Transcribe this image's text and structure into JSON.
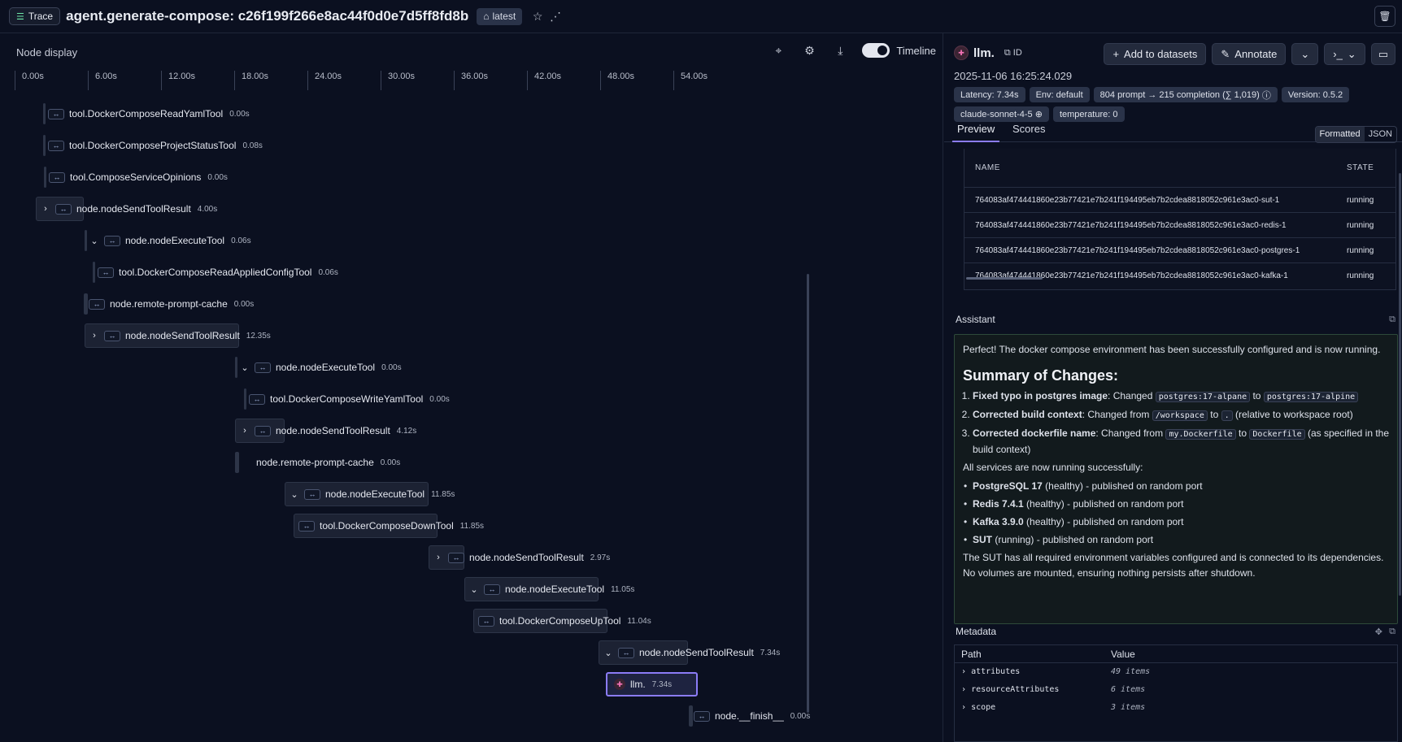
{
  "topbar": {
    "trace_label": "Trace",
    "title": "agent.generate-compose: c26f199f266e8ac44f0d0e7d5ff8fd8b",
    "tag": "latest"
  },
  "left": {
    "header": "Node display",
    "timeline_label": "Timeline",
    "ticks": [
      "0.00s",
      "6.00s",
      "12.00s",
      "18.00s",
      "24.00s",
      "30.00s",
      "36.00s",
      "42.00s",
      "48.00s",
      "54.00s"
    ],
    "nodes": [
      {
        "name": "tool.DockerComposeReadYamlTool",
        "dur": "0.00s"
      },
      {
        "name": "tool.DockerComposeProjectStatusTool",
        "dur": "0.08s"
      },
      {
        "name": "tool.ComposeServiceOpinions",
        "dur": "0.00s"
      },
      {
        "name": "node.nodeSendToolResult",
        "dur": "4.00s"
      },
      {
        "name": "node.nodeExecuteTool",
        "dur": "0.06s"
      },
      {
        "name": "tool.DockerComposeReadAppliedConfigTool",
        "dur": "0.06s"
      },
      {
        "name": "node.remote-prompt-cache",
        "dur": "0.00s"
      },
      {
        "name": "node.nodeSendToolResult",
        "dur": "12.35s"
      },
      {
        "name": "node.nodeExecuteTool",
        "dur": "0.00s"
      },
      {
        "name": "tool.DockerComposeWriteYamlTool",
        "dur": "0.00s"
      },
      {
        "name": "node.nodeSendToolResult",
        "dur": "4.12s"
      },
      {
        "name": "node.remote-prompt-cache",
        "dur": "0.00s"
      },
      {
        "name": "node.nodeExecuteTool",
        "dur": "11.85s"
      },
      {
        "name": "tool.DockerComposeDownTool",
        "dur": "11.85s"
      },
      {
        "name": "node.nodeSendToolResult",
        "dur": "2.97s"
      },
      {
        "name": "node.nodeExecuteTool",
        "dur": "11.05s"
      },
      {
        "name": "tool.DockerComposeUpTool",
        "dur": "11.04s"
      },
      {
        "name": "node.nodeSendToolResult",
        "dur": "7.34s"
      },
      {
        "name": "llm.",
        "dur": "7.34s"
      },
      {
        "name": "node.__finish__",
        "dur": "0.00s"
      }
    ]
  },
  "right": {
    "span_name": "llm.",
    "id_label": "ID",
    "actions": {
      "add": "Add to datasets",
      "annotate": "Annotate"
    },
    "timestamp": "2025-11-06 16:25:24.029",
    "chips": {
      "latency": "Latency: 7.34s",
      "env": "Env: default",
      "tokens": "804 prompt → 215 completion (∑ 1,019)",
      "version": "Version: 0.5.2",
      "model": "claude-sonnet-4-5",
      "temperature": "temperature: 0"
    },
    "tabs": {
      "preview": "Preview",
      "scores": "Scores"
    },
    "format": {
      "formatted": "Formatted",
      "json": "JSON"
    },
    "table": {
      "col_name": "NAME",
      "col_state": "STATE",
      "rows": [
        {
          "name": "764083af474441860e23b77421e7b241f194495eb7b2cdea8818052c961e3ac0-sut-1",
          "state": "running"
        },
        {
          "name": "764083af474441860e23b77421e7b241f194495eb7b2cdea8818052c961e3ac0-redis-1",
          "state": "running"
        },
        {
          "name": "764083af474441860e23b77421e7b241f194495eb7b2cdea8818052c961e3ac0-postgres-1",
          "state": "running"
        },
        {
          "name": "764083af474441860e23b77421e7b241f194495eb7b2cdea8818052c961e3ac0-kafka-1",
          "state": "running"
        }
      ]
    },
    "assistant": {
      "label": "Assistant",
      "intro": "Perfect! The docker compose environment has been successfully configured and is now running.",
      "heading": "Summary of Changes:",
      "c1_bold": "Fixed typo in postgres image",
      "c1_text": ": Changed ",
      "c1_code_a": "postgres:17-alpane",
      "c1_mid": " to ",
      "c1_code_b": "postgres:17-alpine",
      "c2_bold": "Corrected build context",
      "c2_text": ": Changed from ",
      "c2_code_a": "/workspace",
      "c2_mid": " to ",
      "c2_code_b": ".",
      "c2_tail": " (relative to workspace root)",
      "c3_bold": "Corrected dockerfile name",
      "c3_text": ": Changed from ",
      "c3_code_a": "my.Dockerfile",
      "c3_mid": " to ",
      "c3_code_b": "Dockerfile",
      "c3_tail": " (as specified in the build context)",
      "services_intro": "All services are now running successfully:",
      "s1_bold": "PostgreSQL 17",
      "s1_text": " (healthy) - published on random port",
      "s2_bold": "Redis 7.4.1",
      "s2_text": " (healthy) - published on random port",
      "s3_bold": "Kafka 3.9.0",
      "s3_text": " (healthy) - published on random port",
      "s4_bold": "SUT",
      "s4_text": " (running) - published on random port",
      "outro": "The SUT has all required environment variables configured and is connected to its dependencies. No volumes are mounted, ensuring nothing persists after shutdown."
    },
    "metadata": {
      "label": "Metadata",
      "col_path": "Path",
      "col_value": "Value",
      "rows": [
        {
          "key": "attributes",
          "value": "49 items"
        },
        {
          "key": "resourceAttributes",
          "value": "6 items"
        },
        {
          "key": "scope",
          "value": "3 items"
        }
      ]
    }
  }
}
